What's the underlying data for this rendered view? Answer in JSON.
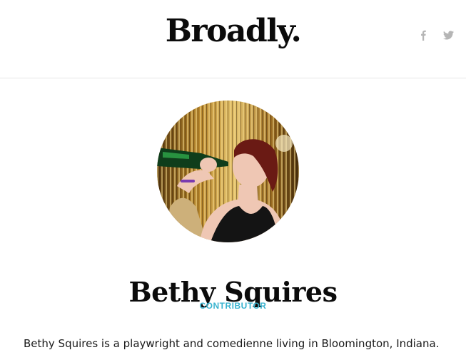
{
  "header": {
    "logo_text": "Broadly.",
    "social": [
      {
        "icon": "facebook-icon",
        "glyph": "f"
      },
      {
        "icon": "twitter-icon"
      }
    ]
  },
  "profile": {
    "photo_icon": "profile-photo",
    "name": "Bethy Squires",
    "role": "CONTRIBUTOR",
    "bio": "Bethy Squires is a playwright and comedienne living in Bloomington, Indiana."
  },
  "colors": {
    "accent": "#38b3cf",
    "icon_gray": "#b5b5b5",
    "text": "#111111"
  }
}
